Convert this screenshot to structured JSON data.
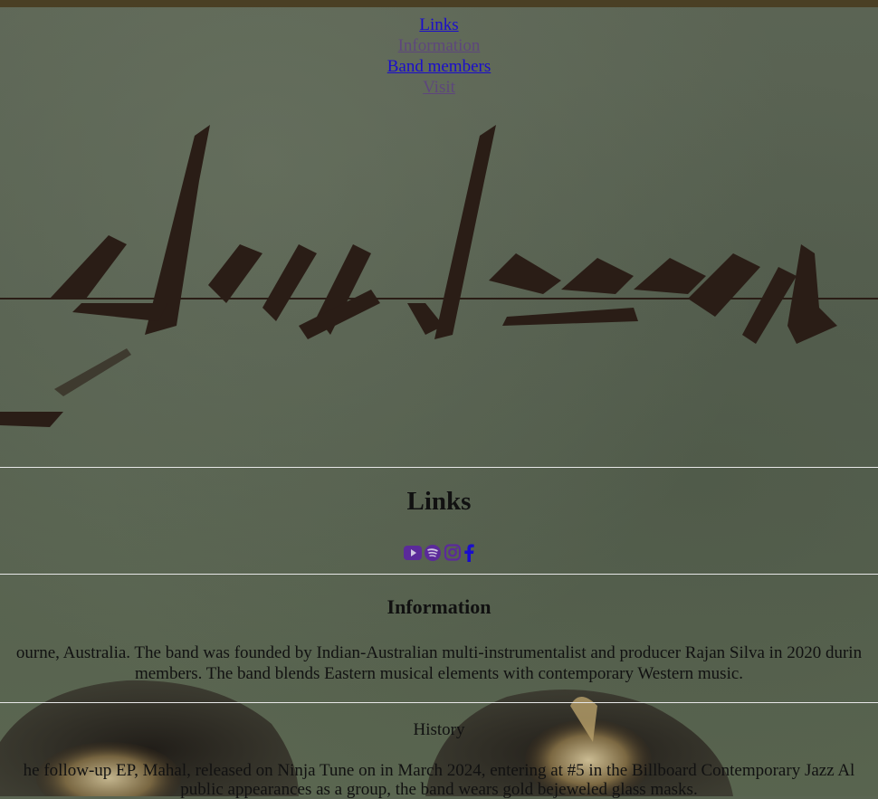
{
  "nav": {
    "links": [
      "Links",
      "Information",
      "Band members",
      "Visit"
    ]
  },
  "sections": {
    "links_title": "Links",
    "social_icons": [
      "youtube-icon",
      "spotify-icon",
      "instagram-icon",
      "facebook-icon"
    ],
    "information_title": "Information",
    "information_line1": "ourne, Australia. The band was founded by Indian-Australian multi-instrumentalist and producer Rajan Silva in 2020 durin",
    "information_line2": "members. The band blends Eastern musical elements with contemporary Western music.",
    "history_title": "History",
    "history_line1": "he follow-up EP, Mahal, released on Ninja Tune on in March 2024, entering at #5 in the Billboard Contemporary Jazz Al",
    "history_line2": "public appearances as a group, the band wears gold bejeweled glass masks."
  },
  "colors": {
    "link": "#1a0dcc",
    "visited": "#5b2a9a",
    "logo": "#2a1d16",
    "background": "#5a6552",
    "topbar": "#4a3f24"
  }
}
